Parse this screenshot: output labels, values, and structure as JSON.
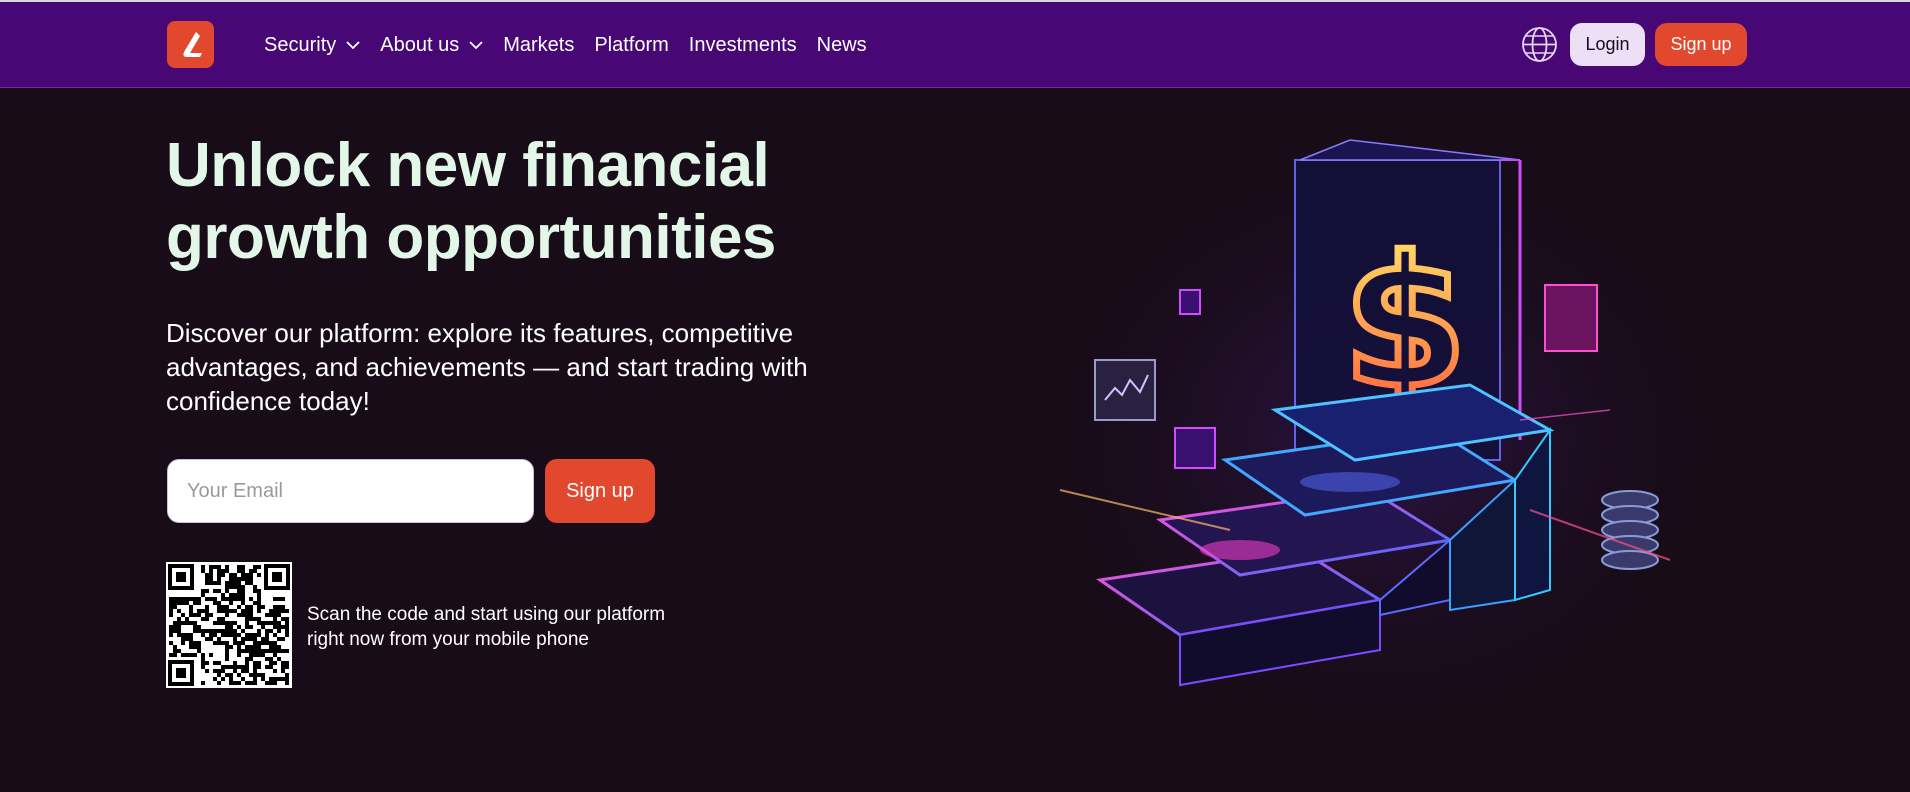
{
  "header": {
    "logo_icon": "brand-logo-icon",
    "nav": [
      {
        "label": "Security",
        "has_dropdown": true
      },
      {
        "label": "About us",
        "has_dropdown": true
      },
      {
        "label": "Markets",
        "has_dropdown": false
      },
      {
        "label": "Platform",
        "has_dropdown": false
      },
      {
        "label": "Investments",
        "has_dropdown": false
      },
      {
        "label": "News",
        "has_dropdown": false
      }
    ],
    "language_icon": "globe-icon",
    "login_label": "Login",
    "signup_label": "Sign up"
  },
  "hero": {
    "title_line1": "Unlock new financial",
    "title_line2": "growth opportunities",
    "subtitle": "Discover our platform: explore its features, competitive advantages, and achievements — and start trading with confidence today!",
    "email_placeholder": "Your Email",
    "signup_label": "Sign up",
    "qr_icon": "qr-code",
    "qr_text_line1": "Scan the code and start using our platform",
    "qr_text_line2": "right now from your mobile phone",
    "illustration_icon": "neon-dollar-staircase-illustration"
  },
  "colors": {
    "header_bg": "#470876",
    "page_bg": "#180c18",
    "accent": "#e2482d",
    "login_bg": "#ede0f6",
    "title_color": "#e3f7e8"
  }
}
